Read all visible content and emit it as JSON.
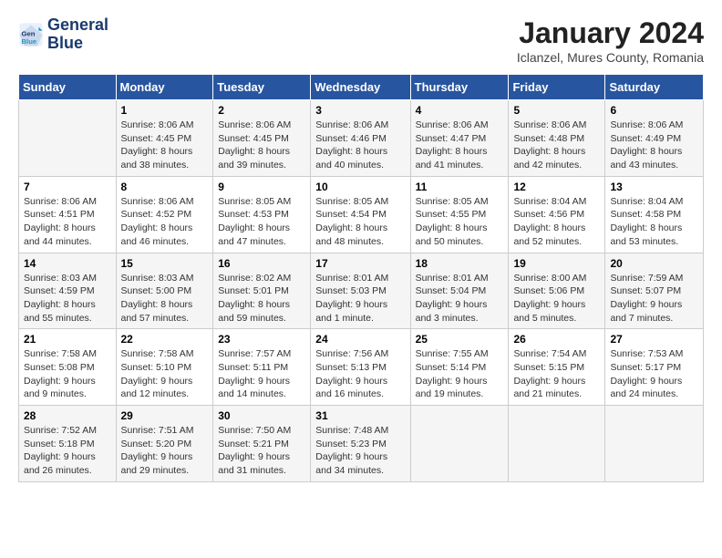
{
  "logo": {
    "line1": "General",
    "line2": "Blue"
  },
  "title": "January 2024",
  "location": "Iclanzel, Mures County, Romania",
  "weekdays": [
    "Sunday",
    "Monday",
    "Tuesday",
    "Wednesday",
    "Thursday",
    "Friday",
    "Saturday"
  ],
  "weeks": [
    [
      {
        "day": "",
        "detail": ""
      },
      {
        "day": "1",
        "detail": "Sunrise: 8:06 AM\nSunset: 4:45 PM\nDaylight: 8 hours\nand 38 minutes."
      },
      {
        "day": "2",
        "detail": "Sunrise: 8:06 AM\nSunset: 4:45 PM\nDaylight: 8 hours\nand 39 minutes."
      },
      {
        "day": "3",
        "detail": "Sunrise: 8:06 AM\nSunset: 4:46 PM\nDaylight: 8 hours\nand 40 minutes."
      },
      {
        "day": "4",
        "detail": "Sunrise: 8:06 AM\nSunset: 4:47 PM\nDaylight: 8 hours\nand 41 minutes."
      },
      {
        "day": "5",
        "detail": "Sunrise: 8:06 AM\nSunset: 4:48 PM\nDaylight: 8 hours\nand 42 minutes."
      },
      {
        "day": "6",
        "detail": "Sunrise: 8:06 AM\nSunset: 4:49 PM\nDaylight: 8 hours\nand 43 minutes."
      }
    ],
    [
      {
        "day": "7",
        "detail": "Sunrise: 8:06 AM\nSunset: 4:51 PM\nDaylight: 8 hours\nand 44 minutes."
      },
      {
        "day": "8",
        "detail": "Sunrise: 8:06 AM\nSunset: 4:52 PM\nDaylight: 8 hours\nand 46 minutes."
      },
      {
        "day": "9",
        "detail": "Sunrise: 8:05 AM\nSunset: 4:53 PM\nDaylight: 8 hours\nand 47 minutes."
      },
      {
        "day": "10",
        "detail": "Sunrise: 8:05 AM\nSunset: 4:54 PM\nDaylight: 8 hours\nand 48 minutes."
      },
      {
        "day": "11",
        "detail": "Sunrise: 8:05 AM\nSunset: 4:55 PM\nDaylight: 8 hours\nand 50 minutes."
      },
      {
        "day": "12",
        "detail": "Sunrise: 8:04 AM\nSunset: 4:56 PM\nDaylight: 8 hours\nand 52 minutes."
      },
      {
        "day": "13",
        "detail": "Sunrise: 8:04 AM\nSunset: 4:58 PM\nDaylight: 8 hours\nand 53 minutes."
      }
    ],
    [
      {
        "day": "14",
        "detail": "Sunrise: 8:03 AM\nSunset: 4:59 PM\nDaylight: 8 hours\nand 55 minutes."
      },
      {
        "day": "15",
        "detail": "Sunrise: 8:03 AM\nSunset: 5:00 PM\nDaylight: 8 hours\nand 57 minutes."
      },
      {
        "day": "16",
        "detail": "Sunrise: 8:02 AM\nSunset: 5:01 PM\nDaylight: 8 hours\nand 59 minutes."
      },
      {
        "day": "17",
        "detail": "Sunrise: 8:01 AM\nSunset: 5:03 PM\nDaylight: 9 hours\nand 1 minute."
      },
      {
        "day": "18",
        "detail": "Sunrise: 8:01 AM\nSunset: 5:04 PM\nDaylight: 9 hours\nand 3 minutes."
      },
      {
        "day": "19",
        "detail": "Sunrise: 8:00 AM\nSunset: 5:06 PM\nDaylight: 9 hours\nand 5 minutes."
      },
      {
        "day": "20",
        "detail": "Sunrise: 7:59 AM\nSunset: 5:07 PM\nDaylight: 9 hours\nand 7 minutes."
      }
    ],
    [
      {
        "day": "21",
        "detail": "Sunrise: 7:58 AM\nSunset: 5:08 PM\nDaylight: 9 hours\nand 9 minutes."
      },
      {
        "day": "22",
        "detail": "Sunrise: 7:58 AM\nSunset: 5:10 PM\nDaylight: 9 hours\nand 12 minutes."
      },
      {
        "day": "23",
        "detail": "Sunrise: 7:57 AM\nSunset: 5:11 PM\nDaylight: 9 hours\nand 14 minutes."
      },
      {
        "day": "24",
        "detail": "Sunrise: 7:56 AM\nSunset: 5:13 PM\nDaylight: 9 hours\nand 16 minutes."
      },
      {
        "day": "25",
        "detail": "Sunrise: 7:55 AM\nSunset: 5:14 PM\nDaylight: 9 hours\nand 19 minutes."
      },
      {
        "day": "26",
        "detail": "Sunrise: 7:54 AM\nSunset: 5:15 PM\nDaylight: 9 hours\nand 21 minutes."
      },
      {
        "day": "27",
        "detail": "Sunrise: 7:53 AM\nSunset: 5:17 PM\nDaylight: 9 hours\nand 24 minutes."
      }
    ],
    [
      {
        "day": "28",
        "detail": "Sunrise: 7:52 AM\nSunset: 5:18 PM\nDaylight: 9 hours\nand 26 minutes."
      },
      {
        "day": "29",
        "detail": "Sunrise: 7:51 AM\nSunset: 5:20 PM\nDaylight: 9 hours\nand 29 minutes."
      },
      {
        "day": "30",
        "detail": "Sunrise: 7:50 AM\nSunset: 5:21 PM\nDaylight: 9 hours\nand 31 minutes."
      },
      {
        "day": "31",
        "detail": "Sunrise: 7:48 AM\nSunset: 5:23 PM\nDaylight: 9 hours\nand 34 minutes."
      },
      {
        "day": "",
        "detail": ""
      },
      {
        "day": "",
        "detail": ""
      },
      {
        "day": "",
        "detail": ""
      }
    ]
  ]
}
